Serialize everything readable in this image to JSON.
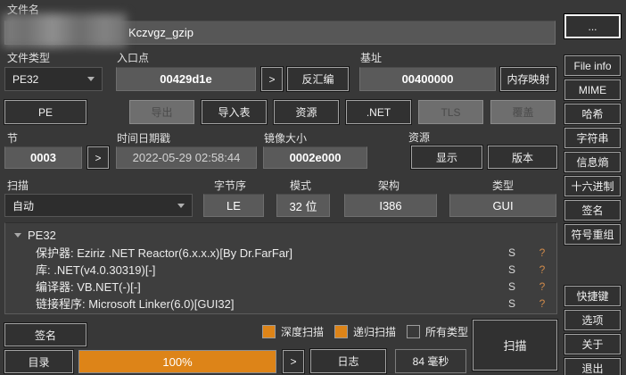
{
  "colors": {
    "accent_orange": "#dd8418",
    "question_mark": "#cf8a4a",
    "background": "#383838"
  },
  "filename": {
    "label": "文件名",
    "value": "Kczvgz_gzip"
  },
  "file_type": {
    "label": "文件类型",
    "value": "PE32"
  },
  "entry_point": {
    "label": "入口点",
    "value": "00429d1e",
    "more": ">",
    "disasm": "反汇编"
  },
  "base_address": {
    "label": "基址",
    "value": "00400000",
    "memmap": "内存映射"
  },
  "buttons_row": {
    "pe": "PE",
    "export": "导出",
    "imports": "导入表",
    "resources": "资源",
    "dotnet": ".NET",
    "tls": "TLS",
    "overlay": "覆盖"
  },
  "sections": {
    "label": "节",
    "value": "0003",
    "more": ">"
  },
  "timestamp": {
    "label": "时间日期戳",
    "value": "2022-05-29 02:58:44"
  },
  "image_size": {
    "label": "镜像大小",
    "value": "0002e000"
  },
  "resources_group": {
    "label": "资源",
    "show": "显示",
    "version": "版本"
  },
  "scan_row": {
    "label": "扫描",
    "method": "自动",
    "endianness_label": "字节序",
    "endianness": "LE",
    "mode_label": "模式",
    "mode": "32 位",
    "arch_label": "架构",
    "arch": "I386",
    "type_label": "类型",
    "type": "GUI"
  },
  "results": {
    "root": "PE32",
    "rows": [
      {
        "text": "保护器: Eziriz .NET Reactor(6.x.x.x)[By Dr.FarFar]",
        "s": "S",
        "q": "?"
      },
      {
        "text": "库: .NET(v4.0.30319)[-]",
        "s": "S",
        "q": "?"
      },
      {
        "text": "编译器: VB.NET(-)[-]",
        "s": "S",
        "q": "?"
      },
      {
        "text": "链接程序: Microsoft Linker(6.0)[GUI32]",
        "s": "S",
        "q": "?"
      }
    ]
  },
  "footer": {
    "signatures": "签名",
    "deep_scan": {
      "label": "深度扫描",
      "checked": true
    },
    "recursive_scan": {
      "label": "递归扫描",
      "checked": true
    },
    "all_types": {
      "label": "所有类型",
      "checked": false
    },
    "scan_button": "扫描",
    "directory": "目录",
    "progress": "100%",
    "more": ">",
    "log": "日志",
    "elapsed": "84 毫秒"
  },
  "sidebar": {
    "browse": "...",
    "top_items": [
      "File info",
      "MIME",
      "哈希",
      "字符串",
      "信息熵",
      "十六进制",
      "签名",
      "符号重组"
    ],
    "bottom_items": [
      "快捷键",
      "选项",
      "关于",
      "退出"
    ]
  }
}
